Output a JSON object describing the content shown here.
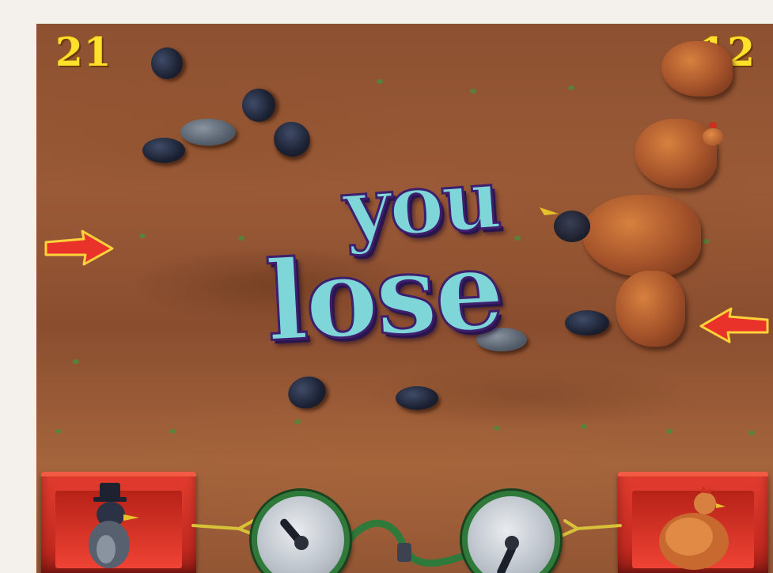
{
  "scores": {
    "left": "21",
    "right": "12"
  },
  "banner": {
    "line1": "you",
    "line2": "lose"
  },
  "colors": {
    "score": "#ffe02a",
    "banner_fill": "#7fd6d8",
    "banner_outline": "#3d1f6e",
    "arrow": "#e8322a",
    "panel": "#d8352a",
    "gauge_ring": "#2f7a3a"
  },
  "icons": {
    "left_arrow": "arrow-right-icon",
    "right_arrow": "arrow-left-icon",
    "left_panel": "crow-player-icon",
    "right_panel": "hen-player-icon"
  }
}
